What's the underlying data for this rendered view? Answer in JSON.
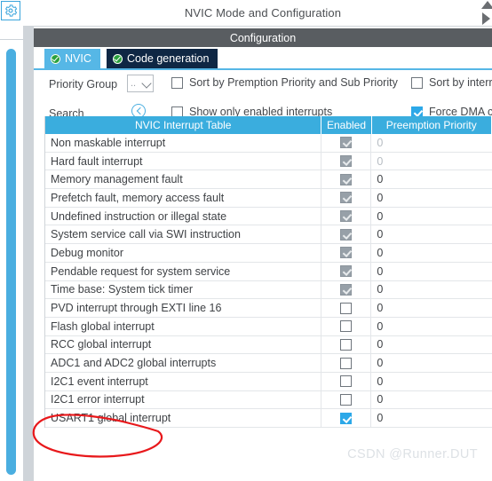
{
  "window": {
    "title": "NVIC Mode and Configuration",
    "section_header": "Configuration",
    "nav_up_icon": "triangle-up-icon",
    "nav_right_icon": "triangle-right-icon",
    "gear_icon": "gear-icon"
  },
  "tabs": [
    {
      "label": "NVIC",
      "active": true,
      "status_icon": "check-circle-icon"
    },
    {
      "label": "Code generation",
      "active": false,
      "status_icon": "check-circle-icon"
    }
  ],
  "controls": {
    "priority_group_label": "Priority Group",
    "priority_group_value": "..",
    "priority_group_chevron": "chevron-down-icon",
    "search_label": "Search",
    "search_icon": "search-circle-icon",
    "checkboxes": [
      {
        "label": "Sort by Premption Priority and Sub Priority",
        "checked": false
      },
      {
        "label": "Sort by interrupts",
        "checked": false
      },
      {
        "label": "Show only enabled interrupts",
        "checked": false
      },
      {
        "label": "Force DMA chan",
        "checked": true
      }
    ]
  },
  "table": {
    "columns": [
      "NVIC Interrupt Table",
      "Enabled",
      "Preemption Priority"
    ],
    "rows": [
      {
        "name": "Non maskable interrupt",
        "enabled": true,
        "locked": true,
        "priority": "0"
      },
      {
        "name": "Hard fault interrupt",
        "enabled": true,
        "locked": true,
        "priority": "0"
      },
      {
        "name": "Memory management fault",
        "enabled": true,
        "locked": true,
        "priority": "0"
      },
      {
        "name": "Prefetch fault, memory access fault",
        "enabled": true,
        "locked": true,
        "priority": "0"
      },
      {
        "name": "Undefined instruction or illegal state",
        "enabled": true,
        "locked": true,
        "priority": "0"
      },
      {
        "name": "System service call via SWI instruction",
        "enabled": true,
        "locked": true,
        "priority": "0"
      },
      {
        "name": "Debug monitor",
        "enabled": true,
        "locked": true,
        "priority": "0"
      },
      {
        "name": "Pendable request for system service",
        "enabled": true,
        "locked": true,
        "priority": "0"
      },
      {
        "name": "Time base: System tick timer",
        "enabled": true,
        "locked": true,
        "priority": "0"
      },
      {
        "name": "PVD interrupt through EXTI line 16",
        "enabled": false,
        "locked": false,
        "priority": "0"
      },
      {
        "name": "Flash global interrupt",
        "enabled": false,
        "locked": false,
        "priority": "0"
      },
      {
        "name": "RCC global interrupt",
        "enabled": false,
        "locked": false,
        "priority": "0"
      },
      {
        "name": "ADC1 and ADC2 global interrupts",
        "enabled": false,
        "locked": false,
        "priority": "0"
      },
      {
        "name": "I2C1 event interrupt",
        "enabled": false,
        "locked": false,
        "priority": "0"
      },
      {
        "name": "I2C1 error interrupt",
        "enabled": false,
        "locked": false,
        "priority": "0"
      },
      {
        "name": "USART1 global interrupt",
        "enabled": true,
        "locked": false,
        "priority": "0"
      }
    ]
  },
  "annotation": {
    "type": "hand-drawn-ellipse",
    "color": "#e8181b",
    "target_row": "USART1 global interrupt"
  },
  "watermark": {
    "text": "CSDN @Runner.DUT"
  },
  "colors": {
    "accent": "#3aadde",
    "tab_active": "#56b7e6",
    "tab_inactive": "#0f2744",
    "header_bar": "#595d61",
    "checked": "#2ca8e8",
    "annotation_red": "#e8181b"
  }
}
